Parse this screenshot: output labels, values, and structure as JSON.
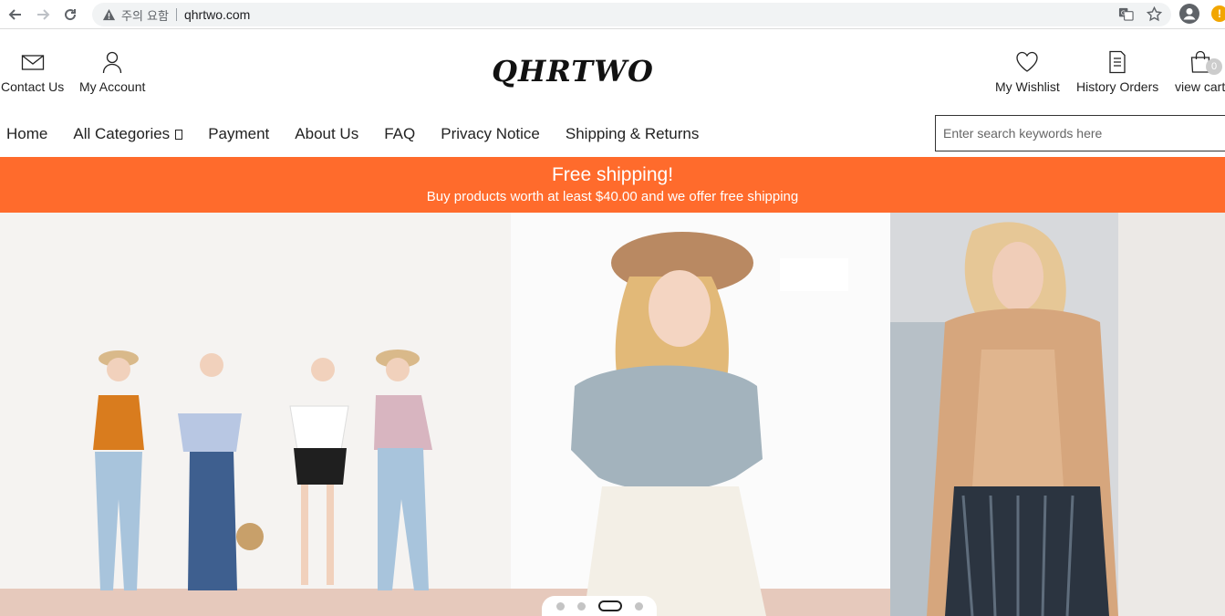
{
  "browser": {
    "warning_text": "주의 요함",
    "url": "qhrtwo.com",
    "extension_badge": "!"
  },
  "header": {
    "contact_label": "Contact Us",
    "account_label": "My Account",
    "logo_text": "QHRTWO",
    "wishlist_label": "My Wishlist",
    "history_label": "History Orders",
    "cart_label": "view cart",
    "cart_count": "0"
  },
  "nav": {
    "items": [
      {
        "label": "Home"
      },
      {
        "label": "All Categories"
      },
      {
        "label": "Payment"
      },
      {
        "label": "About Us"
      },
      {
        "label": "FAQ"
      },
      {
        "label": "Privacy Notice"
      },
      {
        "label": "Shipping & Returns"
      }
    ],
    "search_placeholder": "Enter search keywords here"
  },
  "promo": {
    "title": "Free shipping!",
    "subtitle": "Buy products worth at least $40.00 and we offer free shipping",
    "color": "#ff6b2c"
  },
  "carousel": {
    "slide_count": 4,
    "active_index": 2
  }
}
